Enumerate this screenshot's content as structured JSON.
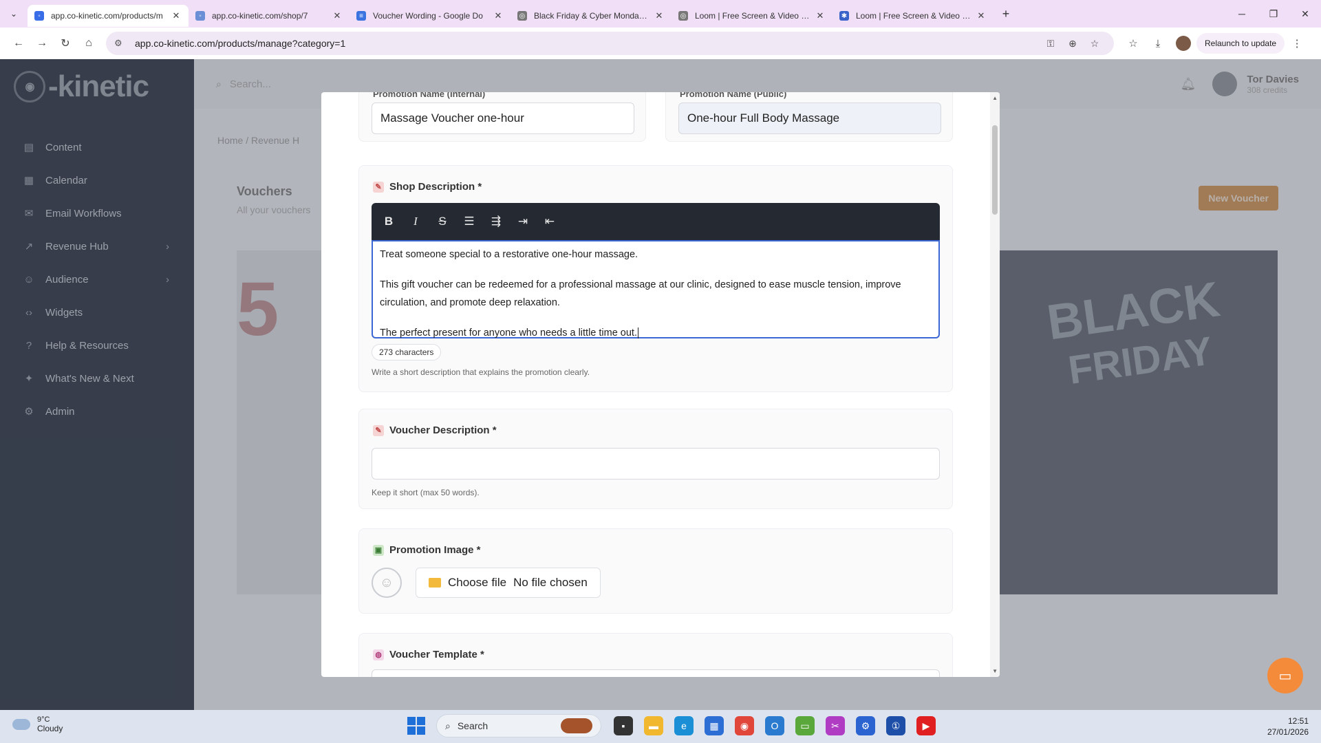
{
  "browser": {
    "tabs": [
      {
        "title": "app.co-kinetic.com/products/m",
        "active": true
      },
      {
        "title": "app.co-kinetic.com/shop/7",
        "active": false
      },
      {
        "title": "Voucher Wording - Google Do",
        "active": false
      },
      {
        "title": "Black Friday & Cyber Monday V",
        "active": false
      },
      {
        "title": "Loom | Free Screen & Video Re",
        "active": false
      },
      {
        "title": "Loom | Free Screen & Video Re",
        "active": false
      }
    ],
    "url": "app.co-kinetic.com/products/manage?category=1",
    "relaunch_label": "Relaunch to update"
  },
  "sidebar": {
    "logo": "-kinetic",
    "items": [
      {
        "label": "Content",
        "icon": "document-icon"
      },
      {
        "label": "Calendar",
        "icon": "calendar-icon"
      },
      {
        "label": "Email Workflows",
        "icon": "mail-icon"
      },
      {
        "label": "Revenue Hub",
        "icon": "trend-icon"
      },
      {
        "label": "Audience",
        "icon": "users-icon"
      },
      {
        "label": "Widgets",
        "icon": "code-icon"
      },
      {
        "label": "Help & Resources",
        "icon": "help-icon"
      },
      {
        "label": "What's New & Next",
        "icon": "sparkle-icon"
      },
      {
        "label": "Admin",
        "icon": "gear-icon"
      }
    ]
  },
  "topbar": {
    "search_placeholder": "Search...",
    "user_name": "Tor Davies",
    "user_credits": "308 credits"
  },
  "page": {
    "breadcrumb": "Home  /  Revenue H",
    "title": "Vouchers",
    "subtitle": "All your vouchers",
    "new_button": "New Voucher",
    "promo_big": "5"
  },
  "modal": {
    "internal_name_label": "Promotion Name (Internal)",
    "internal_name_value": "Massage Voucher one-hour",
    "public_name_label": "Promotion Name (Public)",
    "public_name_value": "One-hour Full Body Massage",
    "shop_description": {
      "title": "Shop Description *",
      "paragraphs": [
        "Treat someone special to a restorative one-hour massage.",
        "This gift voucher can be redeemed for a professional massage at our clinic, designed to ease muscle tension, improve circulation, and promote deep relaxation.",
        "The perfect present for anyone who needs a little time out."
      ],
      "char_count": "273 characters",
      "hint": "Write a short description that explains the promotion clearly."
    },
    "voucher_description": {
      "title": "Voucher Description *",
      "value": "",
      "hint": "Keep it short (max 50 words)."
    },
    "promotion_image": {
      "title": "Promotion Image *",
      "choose_label": "Choose file",
      "no_file": "No file chosen"
    },
    "voucher_template": {
      "title": "Voucher Template *"
    }
  },
  "taskbar": {
    "temperature": "9°C",
    "condition": "Cloudy",
    "search_label": "Search",
    "time": "12:51",
    "date": "27/01/2026"
  }
}
